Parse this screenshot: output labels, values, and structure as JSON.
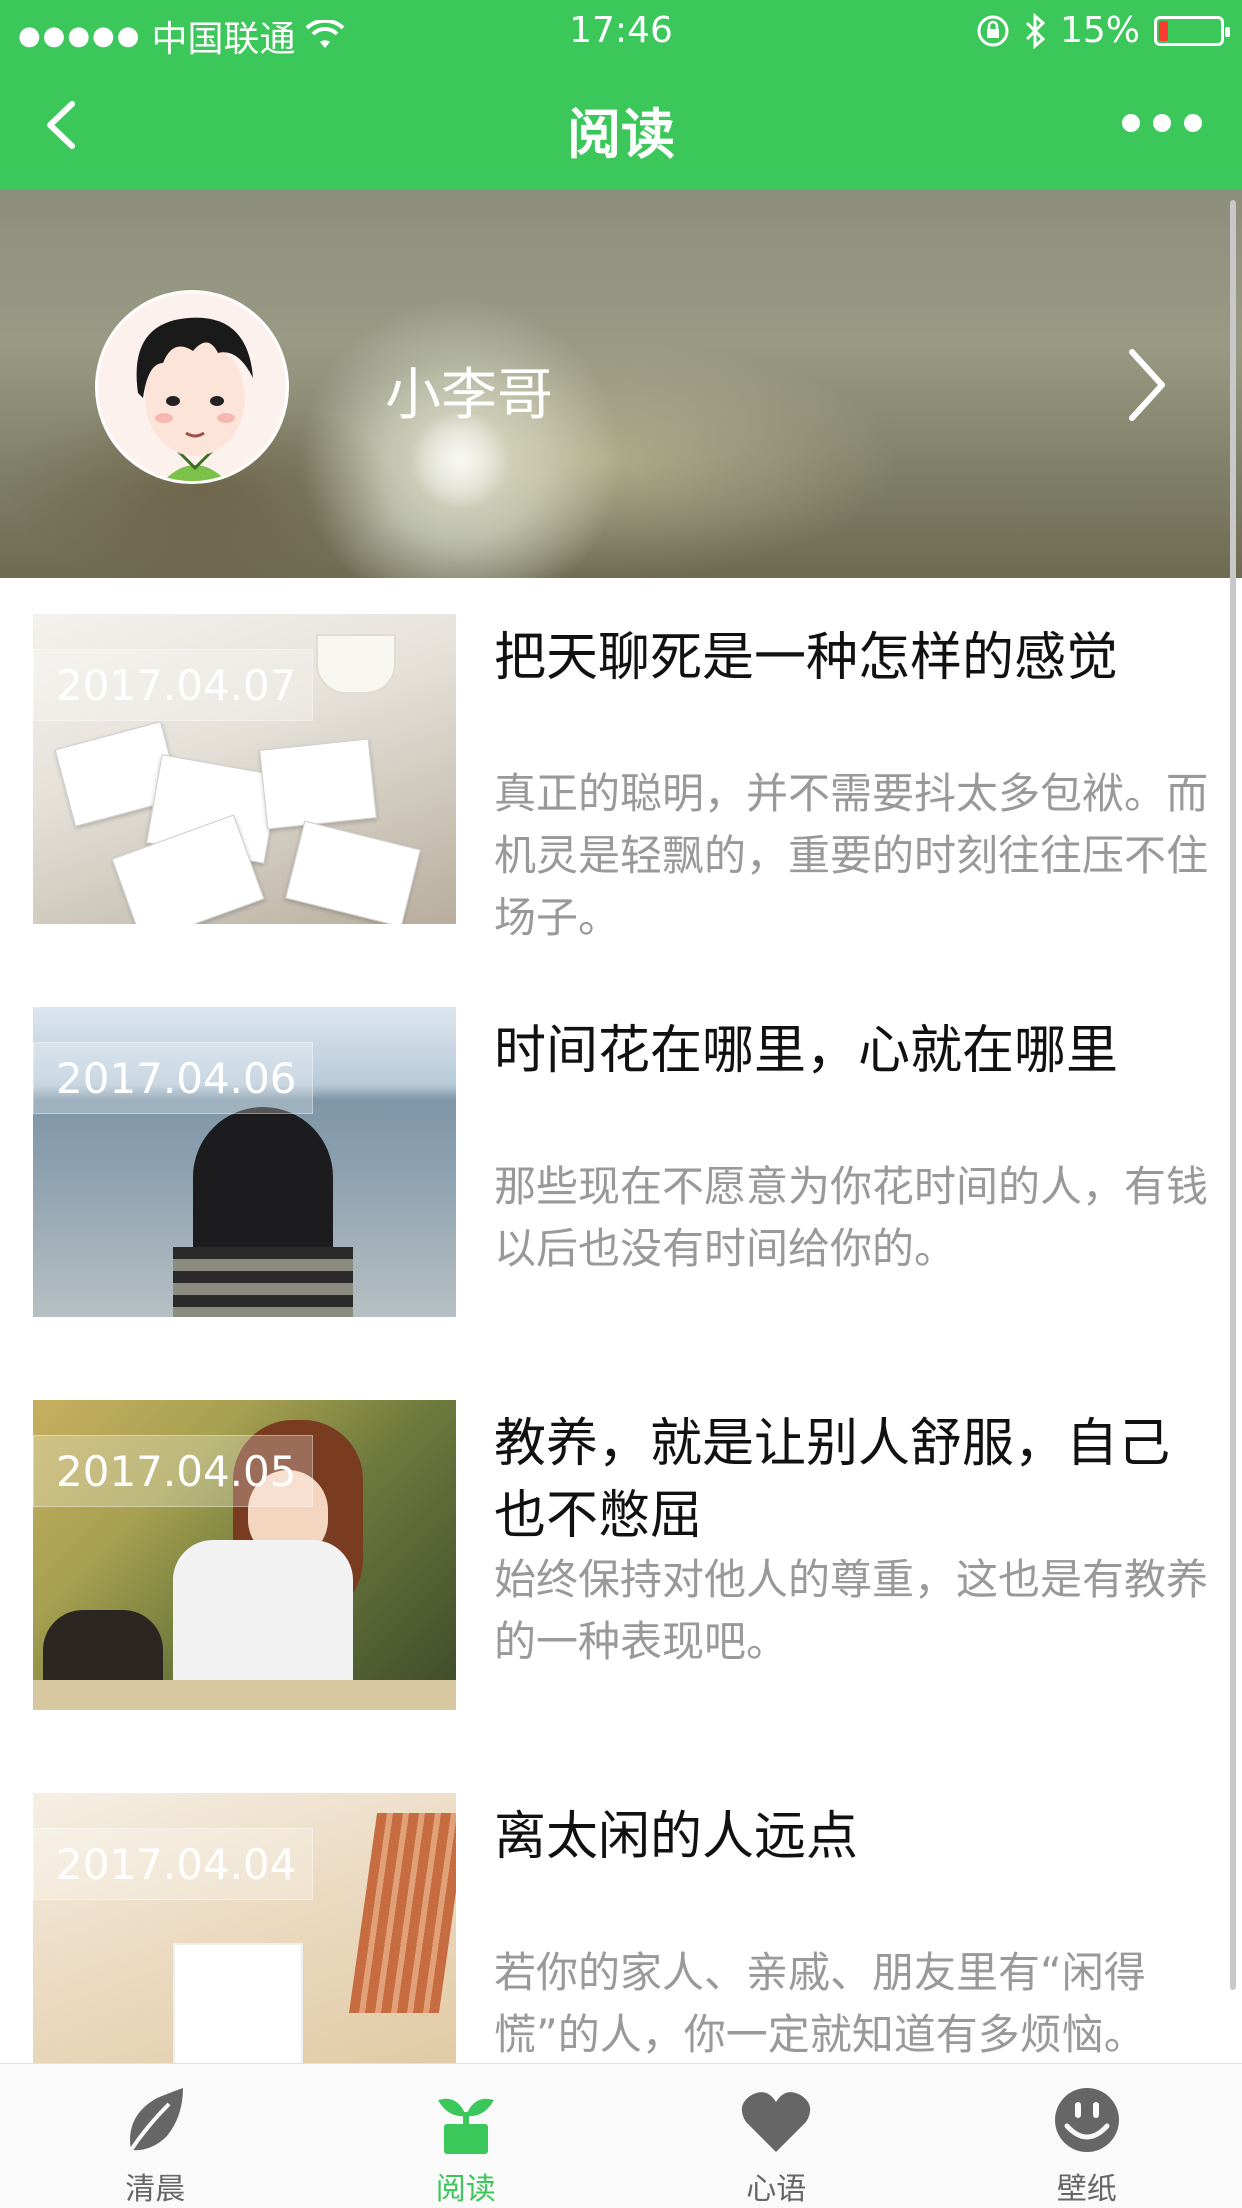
{
  "status_bar": {
    "carrier": "中国联通",
    "time": "17:46",
    "battery": "15%",
    "battery_level": 0.15
  },
  "nav": {
    "title": "阅读",
    "back_icon": "chevron-left-icon",
    "more_icon": "more-dots-icon"
  },
  "profile": {
    "name": "小李哥",
    "arrow_icon": "chevron-right-icon"
  },
  "articles": [
    {
      "date": "2017.04.07",
      "title": "把天聊死是一种怎样的感觉",
      "summary": "真正的聪明，并不需要抖太多包袱。而机灵是轻飘的，重要的时刻往往压不住场子。"
    },
    {
      "date": "2017.04.06",
      "title": "时间花在哪里，心就在哪里",
      "summary": "那些现在不愿意为你花时间的人，有钱以后也没有时间给你的。"
    },
    {
      "date": "2017.04.05",
      "title": "教养，就是让别人舒服，自己也不憋屈",
      "summary": "始终保持对他人的尊重，这也是有教养的一种表现吧。"
    },
    {
      "date": "2017.04.04",
      "title": "离太闲的人远点",
      "summary": "若你的家人、亲戚、朋友里有“闲得慌”的人，你一定就知道有多烦恼。"
    }
  ],
  "tabs": [
    {
      "label": "清晨",
      "icon": "leaf-icon",
      "active": false
    },
    {
      "label": "阅读",
      "icon": "sprout-icon",
      "active": true
    },
    {
      "label": "心语",
      "icon": "heart-icon",
      "active": false
    },
    {
      "label": "壁纸",
      "icon": "smiley-icon",
      "active": false
    }
  ],
  "colors": {
    "brand_green": "#3cc75b",
    "tab_inactive": "#666666",
    "summary_gray": "#999999"
  }
}
